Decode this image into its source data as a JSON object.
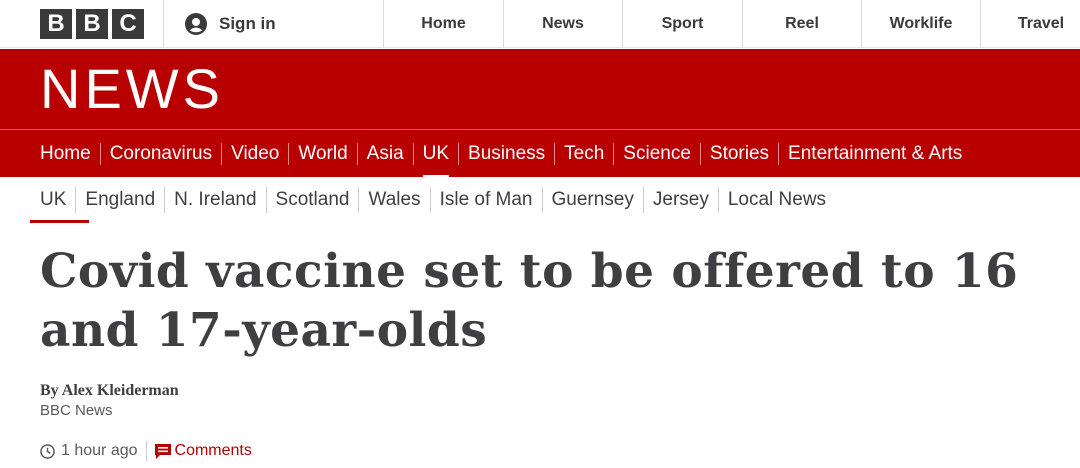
{
  "brand": {
    "letters": [
      "B",
      "B",
      "C"
    ]
  },
  "topbar": {
    "signin_label": "Sign in",
    "nav": [
      "Home",
      "News",
      "Sport",
      "Reel",
      "Worklife",
      "Travel"
    ]
  },
  "news_header": {
    "title": "NEWS"
  },
  "sections": [
    "Home",
    "Coronavirus",
    "Video",
    "World",
    "Asia",
    "UK",
    "Business",
    "Tech",
    "Science",
    "Stories",
    "Entertainment & Arts"
  ],
  "sections_active": "UK",
  "subnav": [
    "UK",
    "England",
    "N. Ireland",
    "Scotland",
    "Wales",
    "Isle of Man",
    "Guernsey",
    "Jersey",
    "Local News"
  ],
  "subnav_active": "UK",
  "article": {
    "headline": "Covid vaccine set to be offered to 16 and 17-year-olds",
    "author": "By Alex Kleiderman",
    "organisation": "BBC News",
    "time": "1 hour ago",
    "comments_label": "Comments"
  },
  "colors": {
    "brand_red": "#b80000",
    "text": "#3f3f42"
  },
  "icons": {
    "user": "user-icon",
    "clock": "clock-icon",
    "comments": "speech-bubble-icon"
  }
}
